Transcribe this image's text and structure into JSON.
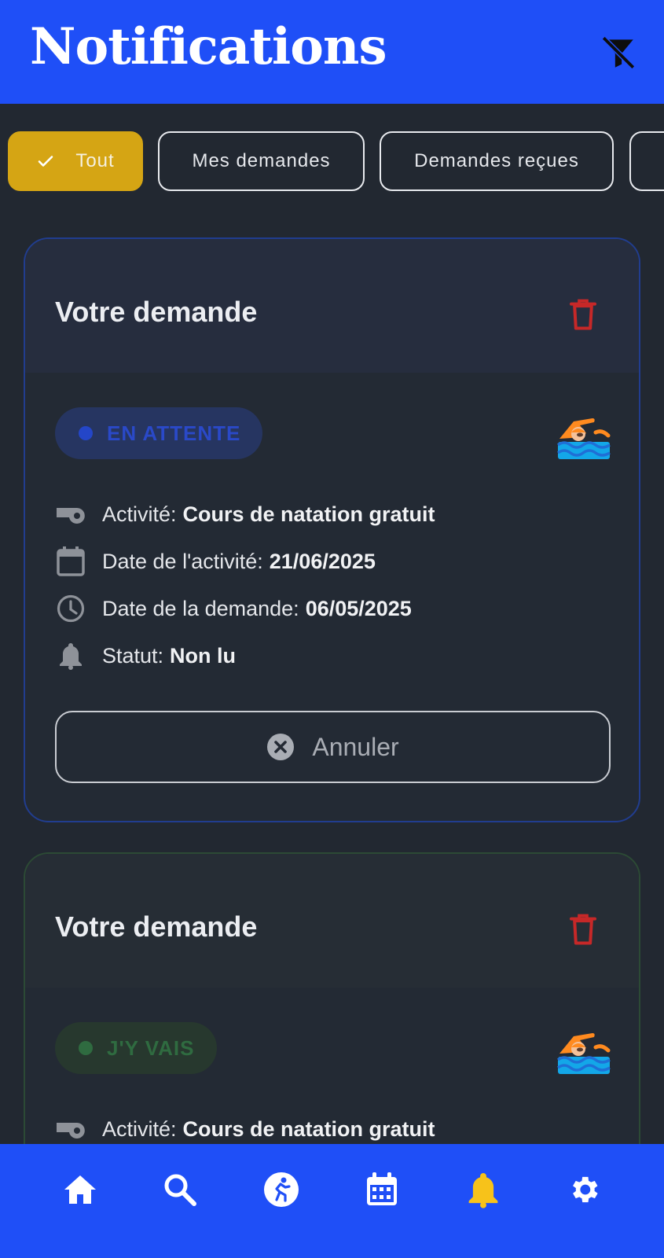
{
  "header": {
    "title": "Notifications",
    "filter_icon": "filter-off-icon"
  },
  "filters": {
    "chips": [
      {
        "label": "Tout",
        "active": true
      },
      {
        "label": "Mes demandes",
        "active": false
      },
      {
        "label": "Demandes reçues",
        "active": false
      }
    ]
  },
  "cards": [
    {
      "title": "Votre demande",
      "status": "EN ATTENTE",
      "activity_label": "Activité:",
      "activity": "Cours de natation gratuit",
      "activity_date_label": "Date de l'activité:",
      "activity_date": "21/06/2025",
      "request_date_label": "Date de la demande:",
      "request_date": "06/05/2025",
      "state_label": "Statut:",
      "state": "Non lu",
      "cancel_label": "Annuler",
      "icon": "swimmer-icon"
    },
    {
      "title": "Votre demande",
      "status": "J'Y VAIS",
      "activity_label": "Activité:",
      "activity": "Cours de natation gratuit",
      "icon": "swimmer-icon"
    }
  ],
  "bottom_nav": [
    {
      "icon": "home-icon"
    },
    {
      "icon": "search-icon"
    },
    {
      "icon": "activity-icon"
    },
    {
      "icon": "calendar-icon"
    },
    {
      "icon": "bell-icon",
      "active": true
    },
    {
      "icon": "settings-icon"
    }
  ],
  "colors": {
    "primary": "#1f4ff7",
    "background": "#222831",
    "active_chip": "#d5a514",
    "danger": "#c62828",
    "active_nav": "#f7c21a"
  }
}
